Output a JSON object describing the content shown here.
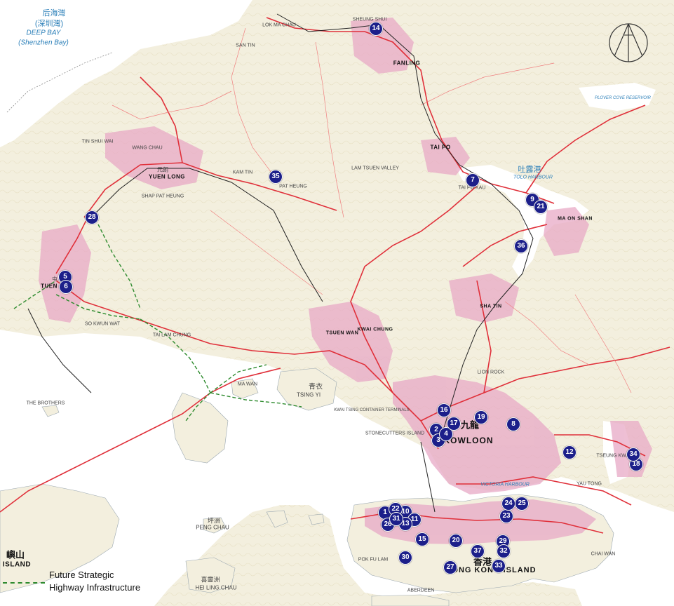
{
  "map": {
    "water_labels": [
      {
        "id": "deep-bay-zh",
        "text": "后海灣"
      },
      {
        "id": "shenzhen-bay-zh",
        "text": "(深圳灣)"
      },
      {
        "id": "deep-bay",
        "text": "DEEP BAY"
      },
      {
        "id": "shenzhen-bay",
        "text": "(Shenzhen Bay)"
      },
      {
        "id": "tolo-harbour-zh",
        "text": "吐露港"
      },
      {
        "id": "tolo-harbour",
        "text": "TOLO HARBOUR"
      },
      {
        "id": "plover-cove",
        "text": "PLOVER COVE RESERVOIR"
      },
      {
        "id": "victoria-harbour",
        "text": "VICTORIA HARBOUR"
      }
    ],
    "place_labels": [
      {
        "id": "sheung-shui",
        "text": "SHEUNG SHUI"
      },
      {
        "id": "fanling",
        "text": "FANLING"
      },
      {
        "id": "tai-po",
        "text": "TAI PO"
      },
      {
        "id": "tai-po-kau",
        "text": "TAI PO KAU"
      },
      {
        "id": "yuen-long",
        "text": "YUEN LONG"
      },
      {
        "id": "yuen-long-zh",
        "text": "元朗"
      },
      {
        "id": "tin-shui-wai",
        "text": "TIN SHUI WAI"
      },
      {
        "id": "tuen-mun",
        "text": "TUEN"
      },
      {
        "id": "tuen-mun-zh",
        "text": "屯"
      },
      {
        "id": "kam-tin",
        "text": "KAM TIN"
      },
      {
        "id": "ma-on-shan",
        "text": "MA ON SHAN"
      },
      {
        "id": "sha-tin",
        "text": "SHA TIN"
      },
      {
        "id": "tsuen-wan",
        "text": "TSUEN WAN"
      },
      {
        "id": "kwai-chung",
        "text": "KWAI CHUNG"
      },
      {
        "id": "tsing-yi",
        "text": "TSING YI"
      },
      {
        "id": "tsing-yi-zh",
        "text": "青衣"
      },
      {
        "id": "kowloon",
        "text": "KOWLOON"
      },
      {
        "id": "kowloon-zh",
        "text": "九龍"
      },
      {
        "id": "hong-kong-island",
        "text": "HONG KONG ISLAND"
      },
      {
        "id": "hong-kong-zh",
        "text": "香港"
      },
      {
        "id": "lantau-zh",
        "text": "嶼山"
      },
      {
        "id": "lantau",
        "text": "ISLAND"
      },
      {
        "id": "tseung-kwan-o",
        "text": "TSEUNG KWAN O"
      },
      {
        "id": "peng-chau",
        "text": "PENG CHAU"
      },
      {
        "id": "peng-chau-zh",
        "text": "坪洲"
      },
      {
        "id": "hei-ling-chau",
        "text": "HEI LING CHAU"
      },
      {
        "id": "hei-ling-chau-zh",
        "text": "喜靈洲"
      },
      {
        "id": "ma-wan",
        "text": "MA WAN"
      },
      {
        "id": "tai-lam-chung",
        "text": "TAI LAM CHUNG"
      },
      {
        "id": "so-kwun-wat",
        "text": "SO KWUN WAT"
      },
      {
        "id": "lok-ma-chau",
        "text": "LOK MA CHAU"
      },
      {
        "id": "san-tin",
        "text": "SAN TIN"
      },
      {
        "id": "the-brothers",
        "text": "THE BROTHERS"
      },
      {
        "id": "stonecutters",
        "text": "STONECUTTERS ISLAND"
      },
      {
        "id": "kwai-tsing-terminals",
        "text": "KWAI TSING CONTAINER TERMINALS"
      },
      {
        "id": "wang-chau",
        "text": "WANG CHAU"
      },
      {
        "id": "shap-pat-heung",
        "text": "SHAP PAT HEUNG"
      },
      {
        "id": "pat-heung",
        "text": "PAT HEUNG"
      },
      {
        "id": "lam-tsuen",
        "text": "LAM TSUEN VALLEY"
      },
      {
        "id": "lion-rock",
        "text": "LION ROCK"
      },
      {
        "id": "yau-tong",
        "text": "YAU TONG"
      },
      {
        "id": "chai-wan",
        "text": "CHAI WAN"
      },
      {
        "id": "pok-fu-lam",
        "text": "POK FU LAM"
      },
      {
        "id": "aberdeen",
        "text": "ABERDEEN"
      }
    ],
    "markers": [
      "1",
      "2",
      "3",
      "4",
      "5",
      "6",
      "7",
      "8",
      "9",
      "10",
      "11",
      "12",
      "13",
      "14",
      "15",
      "16",
      "17",
      "18",
      "19",
      "20",
      "21",
      "22",
      "23",
      "24",
      "25",
      "26",
      "27",
      "28",
      "29",
      "30",
      "31",
      "32",
      "33",
      "34",
      "35",
      "36",
      "37"
    ],
    "legend": {
      "line1": "Future Strategic",
      "line2": "Highway Infrastructure"
    },
    "colors": {
      "land": "#f4f1e4",
      "sea": "#ffffff",
      "urban": "#e7a6c4",
      "road": "#e0303a",
      "railway": "#222222",
      "future_highway": "#2e8b2e",
      "marker": "#1c1f8a",
      "water_text": "#2b7fb8"
    },
    "icons": [
      "north-arrow-icon"
    ]
  }
}
